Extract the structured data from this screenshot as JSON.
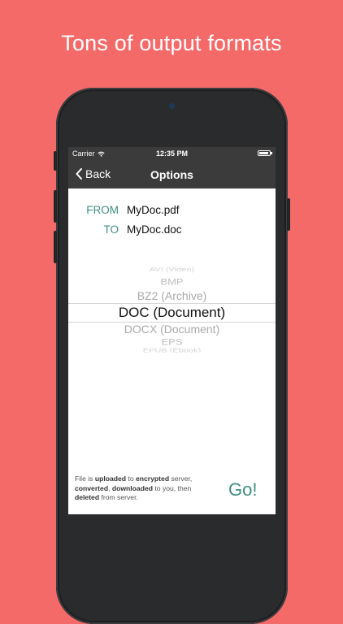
{
  "headline": "Tons of output formats",
  "statusbar": {
    "carrier": "Carrier",
    "time": "12:35 PM",
    "battery_level": 0.9
  },
  "navbar": {
    "back_label": "Back",
    "title": "Options"
  },
  "conversion": {
    "from_label": "FROM",
    "from_value": "MyDoc.pdf",
    "to_label": "TO",
    "to_value": "MyDoc.doc"
  },
  "picker": {
    "items": [
      "AVI (Video)",
      "BMP",
      "BZ2 (Archive)",
      "DOC (Document)",
      "DOCX (Document)",
      "EPS",
      "EPUB (Ebook)"
    ],
    "selected_index": 3
  },
  "footer": {
    "t1": "File is ",
    "b1": "uploaded",
    "t2": " to ",
    "b2": "encrypted",
    "t3": " server,",
    "b3": "converted",
    "t4": ", ",
    "b4": "downloaded",
    "t5": " to you, then",
    "b5": "deleted",
    "t6": " from server."
  },
  "go_label": "Go!",
  "colors": {
    "background": "#f46a69",
    "accent": "#3f8f80",
    "navbar": "#3b3b3b"
  },
  "icons": {
    "wifi": "wifi-icon",
    "battery": "battery-icon",
    "back": "chevron-left-icon"
  }
}
